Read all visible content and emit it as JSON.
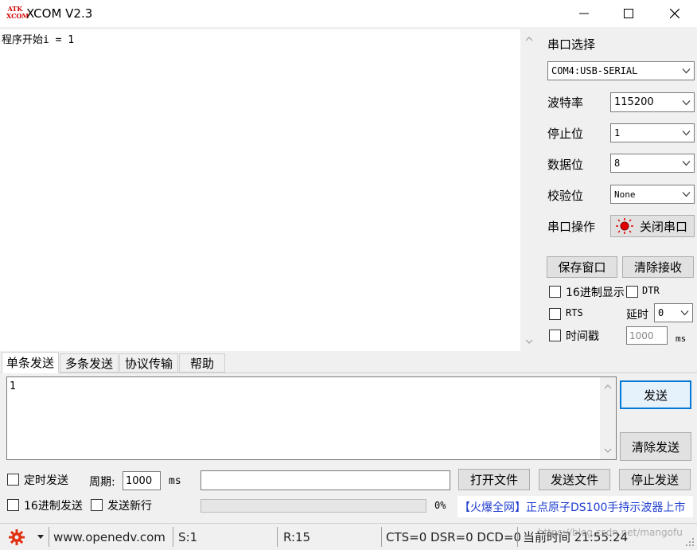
{
  "window": {
    "logo_top": "ATK",
    "logo_bottom": "XCOM",
    "title": "XCOM V2.3"
  },
  "receive": {
    "text": "程序开始i = 1"
  },
  "settings": {
    "port_select_label": "串口选择",
    "port_value": "COM4:USB-SERIAL",
    "baud_label": "波特率",
    "baud_value": "115200",
    "stop_label": "停止位",
    "stop_value": "1",
    "data_label": "数据位",
    "data_value": "8",
    "parity_label": "校验位",
    "parity_value": "None",
    "op_label": "串口操作",
    "op_button": "关闭串口",
    "save_window": "保存窗口",
    "clear_receive": "清除接收",
    "hex_display": "16进制显示",
    "dtr": "DTR",
    "rts": "RTS",
    "delay_label": "延时",
    "delay_value": "0",
    "timestamp": "时间戳",
    "timestamp_value": "1000",
    "ms": "ms"
  },
  "tabs": [
    "单条发送",
    "多条发送",
    "协议传输",
    "帮助"
  ],
  "send": {
    "text": "1",
    "send_button": "发送",
    "clear_send": "清除发送",
    "timed_send": "定时发送",
    "period_label": "周期:",
    "period_value": "1000",
    "period_unit": "ms",
    "open_file": "打开文件",
    "send_file": "发送文件",
    "stop_send": "停止发送",
    "hex_send": "16进制发送",
    "send_newline": "发送新行",
    "progress": 0,
    "progress_text": "0%",
    "ad_text": "【火爆全网】正点原子DS100手持示波器上市",
    "accent_color": "#1e3cd0"
  },
  "status": {
    "website": "www.openedv.com",
    "sent": "S:1",
    "received": "R:15",
    "signals": "CTS=0 DSR=0 DCD=0",
    "time": "当前时间 21:55:24",
    "watermark": "https://blog.csdn.net/mangofu"
  }
}
